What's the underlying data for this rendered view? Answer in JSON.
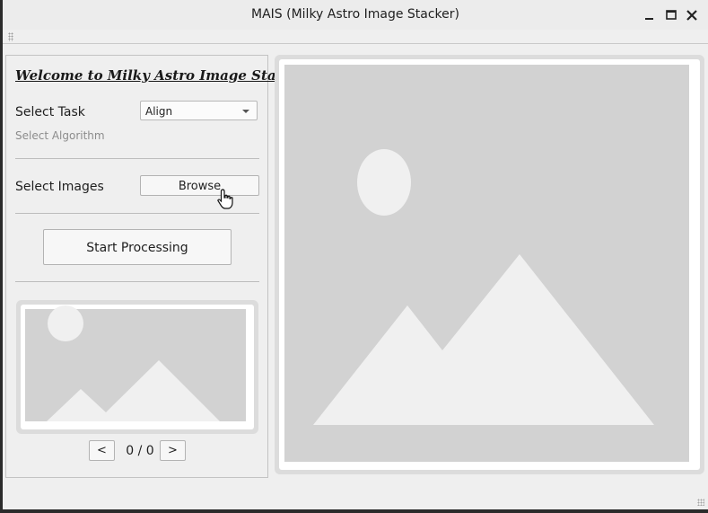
{
  "window": {
    "title": "MAIS (Milky Astro Image Stacker)"
  },
  "icons": {
    "minimize": "minimize-icon",
    "maximize": "maximize-icon",
    "close": "close-icon",
    "placeholder": "image-placeholder-icon",
    "cursor": "hand-pointer-icon"
  },
  "sidebar": {
    "welcome": "Welcome to Milky Astro Image Stacker",
    "task_label": "Select Task",
    "task_value": "Align",
    "algorithm_label": "Select Algorithm",
    "images_label": "Select Images",
    "browse_label": "Browse",
    "start_label": "Start Processing",
    "prev_label": "<",
    "next_label": ">",
    "counter": "0 / 0"
  },
  "colors": {
    "window_bg": "#efefef",
    "placeholder_bg": "#d2d2d2",
    "placeholder_shape": "#f0f0f0",
    "frame": "#dcdcdc"
  }
}
